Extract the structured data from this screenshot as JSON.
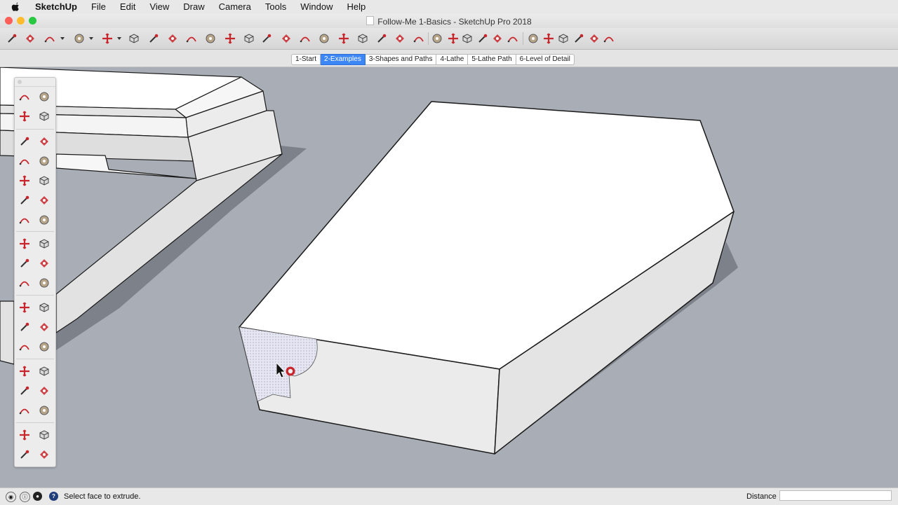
{
  "menubar": {
    "app_name": "SketchUp",
    "items": [
      "File",
      "Edit",
      "View",
      "Draw",
      "Camera",
      "Tools",
      "Window",
      "Help"
    ]
  },
  "window": {
    "title": "Follow-Me 1-Basics - SketchUp Pro 2018",
    "traffic_lights": {
      "close": "#fc5f57",
      "minimize": "#fdbc2e",
      "zoom": "#28c840"
    }
  },
  "toolbar_icons": [
    "select-icon",
    "eraser-icon",
    "line-icon",
    "arc-icon",
    "circle-icon",
    "push-pull-icon",
    "follow-me-icon",
    "move-icon",
    "rotate-icon",
    "scale-icon",
    "tape-measure-icon",
    "text-icon",
    "paint-bucket-icon",
    "orbit-icon",
    "pan-icon",
    "zoom-icon",
    "zoom-extents-icon",
    "components-icon",
    "materials-icon",
    "styles-icon",
    "warehouse-icon",
    "iso-view-icon",
    "top-view-icon",
    "front-view-icon",
    "right-view-icon",
    "back-view-icon",
    "left-view-icon",
    "xray-icon",
    "wireframe-icon",
    "hidden-line-icon",
    "shaded-icon",
    "shaded-textures-icon",
    "monochrome-icon"
  ],
  "scene_tabs": {
    "items": [
      "1-Start",
      "2-Examples",
      "3-Shapes and Paths",
      "4-Lathe",
      "5-Lathe Path",
      "6-Level of Detail"
    ],
    "active_index": 1
  },
  "tool_palette": [
    "select-icon",
    "component-icon",
    "paint-bucket-icon",
    "eraser-icon",
    "line-icon",
    "freehand-icon",
    "rectangle-icon",
    "rotated-rectangle-icon",
    "circle-icon",
    "polygon-icon",
    "arc-icon",
    "arc-2-icon",
    "pie-icon",
    "3-point-arc-icon",
    "move-icon",
    "push-pull-icon",
    "rotate-icon",
    "follow-me-icon",
    "scale-icon",
    "offset-icon",
    "tape-measure-icon",
    "dimension-icon",
    "protractor-icon",
    "text-icon",
    "axes-icon",
    "3d-text-icon",
    "orbit-icon",
    "pan-icon",
    "zoom-icon",
    "zoom-window-icon",
    "zoom-extents-icon",
    "previous-view-icon",
    "position-camera-icon",
    "walk-icon",
    "look-around-icon",
    "section-plane-icon"
  ],
  "status": {
    "message": "Select face to extrude.",
    "measurement_label": "Distance",
    "measurement_value": ""
  },
  "colors": {
    "accent": "#3d86f5",
    "tool_red": "#c8262c",
    "viewport_bg": "#a9aeb6",
    "face_front": "#ffffff",
    "face_side": "#e9e9e9",
    "profile_face": "#e6e6f2"
  }
}
